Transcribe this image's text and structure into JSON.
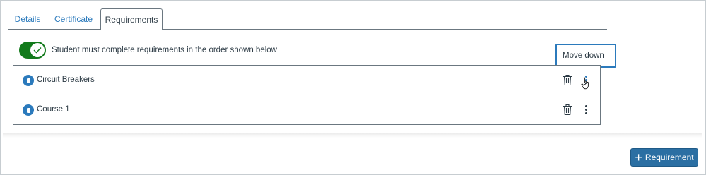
{
  "tabs": [
    {
      "label": "Details"
    },
    {
      "label": "Certificate"
    },
    {
      "label": "Requirements"
    }
  ],
  "order_toggle": {
    "label": "Student must complete requirements in the order shown below",
    "on": true
  },
  "tooltip": {
    "text": "Move down"
  },
  "requirements": [
    {
      "name": "Circuit Breakers"
    },
    {
      "name": "Course 1"
    }
  ],
  "add_button": {
    "label": "Requirement",
    "icon": "plus-icon"
  },
  "colors": {
    "accent": "#2b7abc",
    "toggle_on": "#127a1b",
    "button": "#2b6fa3"
  }
}
